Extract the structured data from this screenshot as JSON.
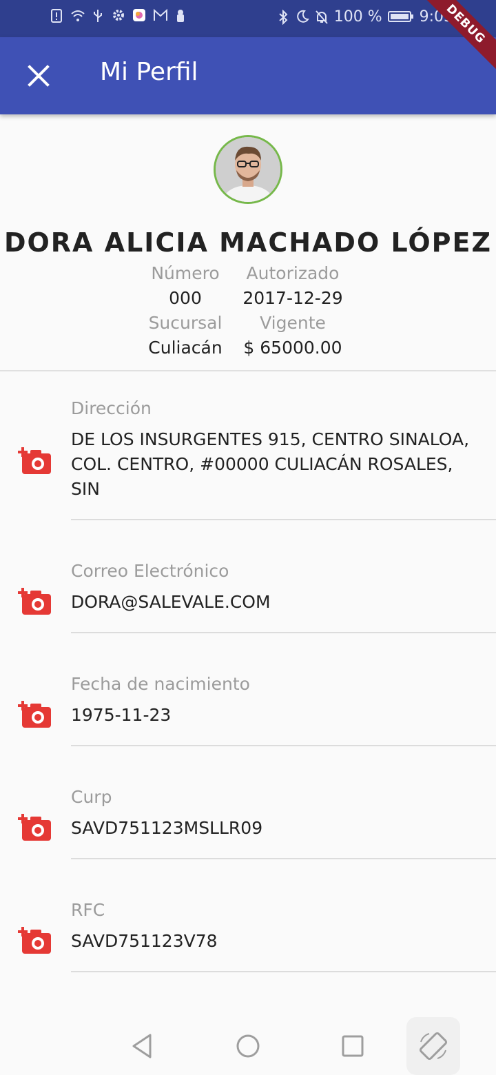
{
  "status_bar": {
    "battery": "100 %",
    "time": "9:05",
    "left_icons": [
      "alert-icon",
      "wifi-icon",
      "usb-icon",
      "settings-icon",
      "app-icon",
      "gmail-icon",
      "keyhole-icon"
    ],
    "right_icons": [
      "bluetooth-icon",
      "moon-icon",
      "bell-off-icon",
      "battery-icon"
    ]
  },
  "debug_banner": "DEBUG",
  "app_bar": {
    "title": "Mi Perfil",
    "close_icon": "close-icon",
    "color": "#3f51b5"
  },
  "profile": {
    "name": "DORA ALICIA MACHADO LÓPEZ",
    "numero_label": "Número",
    "numero_value": "000",
    "autorizado_label": "Autorizado",
    "autorizado_value": "2017-12-29",
    "sucursal_label": "Sucursal",
    "sucursal_value": "Culiacán",
    "vigente_label": "Vigente",
    "vigente_value": "$ 65000.00",
    "avatar_border_color": "#76b84a"
  },
  "fields": [
    {
      "label": "Dirección",
      "value": "DE LOS INSURGENTES 915, CENTRO SINALOA, COL. CENTRO, #00000 CULIACÁN ROSALES, SIN",
      "icon": "add-a-photo-icon"
    },
    {
      "label": "Correo Electrónico",
      "value": "DORA@SALEVALE.COM",
      "icon": "add-a-photo-icon"
    },
    {
      "label": "Fecha de nacimiento",
      "value": "1975-11-23",
      "icon": "add-a-photo-icon"
    },
    {
      "label": "Curp",
      "value": "SAVD751123MSLLR09",
      "icon": "add-a-photo-icon"
    },
    {
      "label": "RFC",
      "value": "SAVD751123V78",
      "icon": "add-a-photo-icon"
    }
  ],
  "icon_color": "#e53935",
  "nav_bar": {
    "icons": [
      "back-icon",
      "home-icon",
      "recents-icon",
      "rotate-icon"
    ]
  }
}
